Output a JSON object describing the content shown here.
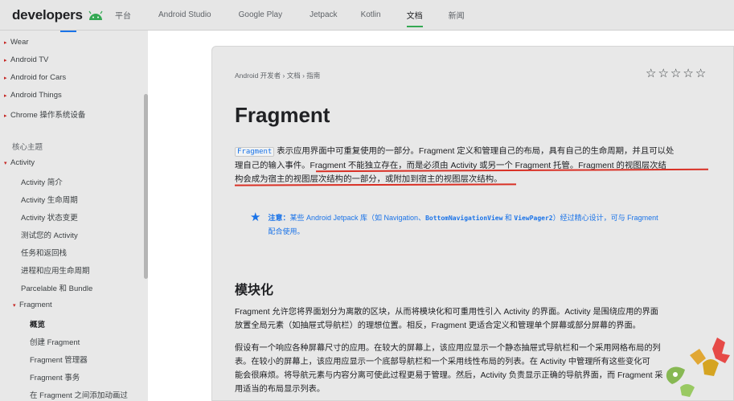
{
  "nav": {
    "logo_text": "developers",
    "items": [
      "平台",
      "Android Studio",
      "Google Play",
      "Jetpack",
      "Kotlin",
      "文档",
      "新闻"
    ],
    "active_index": 5
  },
  "sidebar": {
    "items": [
      {
        "label": "Wear",
        "kind": "collapsed"
      },
      {
        "label": "Android TV",
        "kind": "collapsed"
      },
      {
        "label": "Android for Cars",
        "kind": "collapsed"
      },
      {
        "label": "Android Things",
        "kind": "collapsed"
      },
      {
        "label": "Chrome 操作系统设备",
        "kind": "collapsed"
      },
      {
        "label": "核心主题",
        "kind": "heading"
      },
      {
        "label": "Activity",
        "kind": "expanded"
      },
      {
        "label": "Activity 简介",
        "kind": "child"
      },
      {
        "label": "Activity 生命周期",
        "kind": "child"
      },
      {
        "label": "Activity 状态变更",
        "kind": "child"
      },
      {
        "label": "测试您的 Activity",
        "kind": "child"
      },
      {
        "label": "任务和返回栈",
        "kind": "child"
      },
      {
        "label": "进程和应用生命周期",
        "kind": "child"
      },
      {
        "label": "Parcelable 和 Bundle",
        "kind": "child"
      },
      {
        "label": "Fragment",
        "kind": "expanded-child"
      },
      {
        "label": "概览",
        "kind": "grandchild-active"
      },
      {
        "label": "创建 Fragment",
        "kind": "grandchild"
      },
      {
        "label": "Fragment 管理器",
        "kind": "grandchild"
      },
      {
        "label": "Fragment 事务",
        "kind": "grandchild"
      },
      {
        "label": "在 Fragment 之间添加动画过",
        "kind": "grandchild"
      }
    ]
  },
  "page": {
    "breadcrumb": "Android 开发者  ›  文档  ›  指南",
    "title": "Fragment",
    "intro_code": "Fragment",
    "intro_line1": " 表示应用界面中可重复使用的一部分。Fragment 定义和管理自己的布局，具有自己的生命周期，并且可以处",
    "intro_line2": "理自己的输入事件。Fragment 不能独立存在，而是必须由 Activity 或另一个 Fragment 托管。Fragment 的视图层次结",
    "intro_line3": "构会成为宿主的视图层次结构的一部分，或附加到宿主的视图层次结构。",
    "note_label": "注意：",
    "note_text_a": "某些 Android Jetpack 库（如 Navigation、",
    "note_code1": "BottomNavigationView",
    "note_text_b": " 和 ",
    "note_code2": "ViewPager2",
    "note_text_c": "）经过精心设计，可与 Fragment",
    "note_line2": "配合使用。",
    "section_title": "模块化",
    "para1_line1": "Fragment 允许您将界面划分为离散的区块，从而将模块化和可重用性引入 Activity 的界面。Activity 是围绕应用的界面",
    "para1_line2": "放置全局元素（如抽屉式导航栏）的理想位置。相反，Fragment 更适合定义和管理单个屏幕或部分屏幕的界面。",
    "para2_line1": "假设有一个响应各种屏幕尺寸的应用。在较大的屏幕上，该应用应显示一个静态抽屉式导航栏和一个采用网格布局的列",
    "para2_line2": "表。在较小的屏幕上，该应用应显示一个底部导航栏和一个采用线性布局的列表。在 Activity 中管理所有这些变化可",
    "para2_line3": "能会很麻烦。将导航元素与内容分离可使此过程更易于管理。然后，Activity 负责显示正确的导航界面，而 Fragment 采",
    "para2_line4": "用适当的布局显示列表。",
    "rating_stars": 5
  },
  "colors": {
    "accent_green": "#34a853",
    "link_blue": "#1a73e8",
    "underline_red": "#d93025",
    "tri_red": "#c5221f"
  }
}
